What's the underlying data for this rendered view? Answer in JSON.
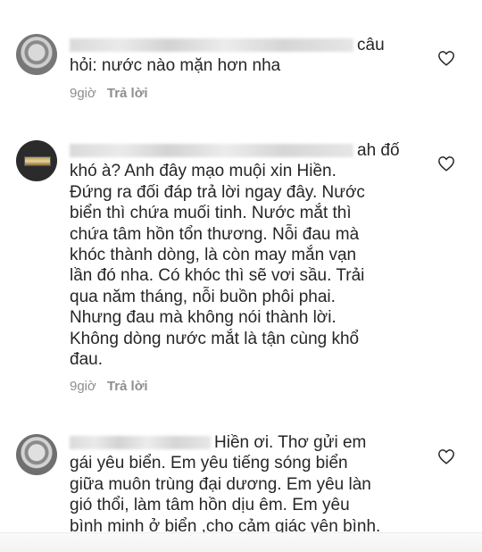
{
  "comments": [
    {
      "lines": [
        "câu",
        "hỏi: nước nào mặn hơn nha"
      ],
      "time": "9giờ",
      "reply_label": "Trả lời"
    },
    {
      "lines": [
        "ah đố",
        "khó à? Anh đây mạo muội  xin Hiền.",
        "Đứng ra đối đáp trả lời ngay đây. Nước",
        "biển thì chứa muối tinh. Nước mắt thì",
        "chứa tâm hồn tổn thương. Nỗi đau mà",
        "khóc thành dòng, là còn may mắn vạn",
        "lần đó nha. Có khóc thì sẽ vơi sầu. Trải",
        "qua năm tháng, nỗi buồn phôi phai.",
        "Nhưng đau mà không nói thành lời.",
        "Không dòng nước mắt là tận cùng khổ",
        "đau."
      ],
      "time": "9giờ",
      "reply_label": "Trả lời"
    },
    {
      "lines": [
        "Hiền ơi.  Thơ gửi em",
        "gái yêu biển.  Em yêu tiếng sóng biển",
        "giữa muôn trùng đại dương. Em yêu làn",
        "gió thổi, làm tâm hồn dịu êm. Em yêu",
        "bình minh ở biển ,cho cảm giác yên bình."
      ]
    }
  ],
  "icons": {
    "like": "heart-outline-icon",
    "avatar": "user-avatar"
  },
  "colors": {
    "text": "#262626",
    "meta": "#8e8e8e",
    "heart_stroke": "#262626"
  }
}
